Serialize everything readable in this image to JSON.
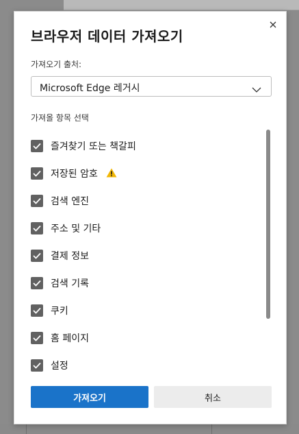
{
  "dialog": {
    "title": "브라우저 데이터 가져오기",
    "source_label": "가져오기 출처:",
    "source_value": "Microsoft Edge 레거시",
    "items_label": "가져올 항목 선택",
    "items": [
      {
        "label": "즐겨찾기 또는 책갈피",
        "checked": true,
        "warning": false
      },
      {
        "label": "저장된 암호",
        "checked": true,
        "warning": true
      },
      {
        "label": "검색 엔진",
        "checked": true,
        "warning": false
      },
      {
        "label": "주소 및 기타",
        "checked": true,
        "warning": false
      },
      {
        "label": "결제 정보",
        "checked": true,
        "warning": false
      },
      {
        "label": "검색 기록",
        "checked": true,
        "warning": false
      },
      {
        "label": "쿠키",
        "checked": true,
        "warning": false
      },
      {
        "label": "홈 페이지",
        "checked": true,
        "warning": false
      },
      {
        "label": "설정",
        "checked": true,
        "warning": false
      }
    ],
    "import_button": "가져오기",
    "cancel_button": "취소"
  },
  "colors": {
    "primary": "#1a73c9",
    "checkbox": "#616161",
    "warning": "#f2b705"
  },
  "icons": {
    "close": "close-icon",
    "chevron": "chevron-down-icon",
    "check": "checkmark-icon",
    "warning": "warning-icon"
  }
}
